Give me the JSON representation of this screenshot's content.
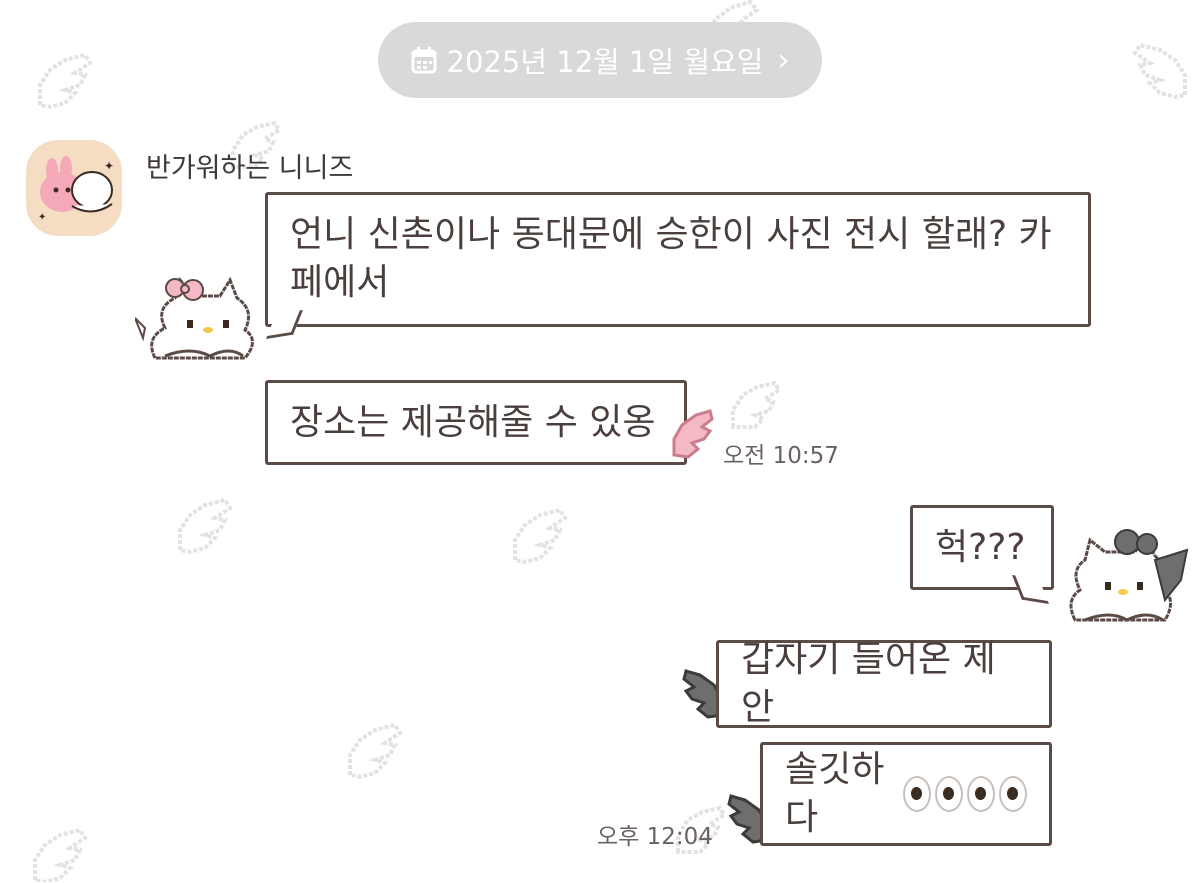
{
  "date_header": {
    "icon": "calendar-icon",
    "label": "2025년 12월 1일 월요일",
    "chevron": "›"
  },
  "sender": {
    "name": "반가워하는 니니즈"
  },
  "messages_in": [
    {
      "text": "언니 신촌이나 동대문에 승한이 사진 전시 할래? 카페에서"
    },
    {
      "text": "장소는 제공해줄 수 있옹"
    }
  ],
  "time_in": "오전 10:57",
  "messages_out": [
    {
      "text": "헉???"
    },
    {
      "text": "갑자기 들어온 제안"
    },
    {
      "text": "솔깃하다"
    }
  ],
  "time_out": "오후 12:04",
  "colors": {
    "bubble_border": "#5a4b47",
    "date_pill": "#d9d9d9",
    "wing_pattern": "#e6e2e2",
    "pink_accent": "#f4b9c4"
  }
}
